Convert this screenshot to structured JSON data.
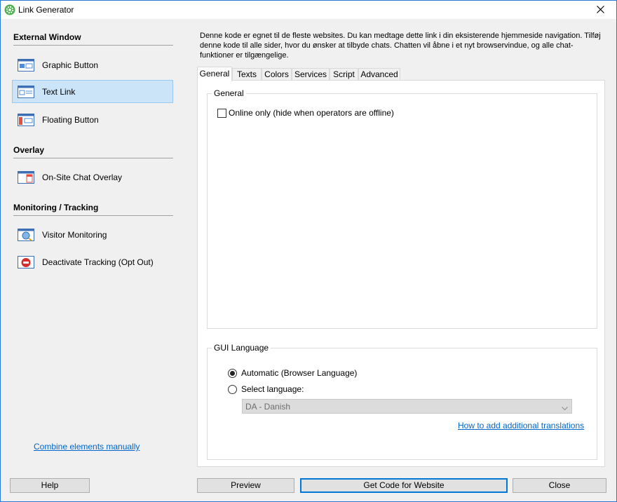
{
  "window": {
    "title": "Link Generator"
  },
  "sidebar": {
    "sections": [
      {
        "title": "External Window"
      },
      {
        "title": "Overlay"
      },
      {
        "title": "Monitoring / Tracking"
      }
    ],
    "items": [
      {
        "label": "Graphic Button",
        "icon": "graphic-button-icon"
      },
      {
        "label": "Text Link",
        "icon": "text-link-icon",
        "selected": true
      },
      {
        "label": "Floating Button",
        "icon": "floating-button-icon"
      },
      {
        "label": "On-Site Chat Overlay",
        "icon": "chat-overlay-icon"
      },
      {
        "label": "Visitor Monitoring",
        "icon": "visitor-monitoring-icon"
      },
      {
        "label": "Deactivate Tracking (Opt Out)",
        "icon": "deactivate-tracking-icon"
      }
    ],
    "combine_link": "Combine elements manually"
  },
  "main": {
    "intro": "Denne kode er egnet til de fleste websites. Du kan medtage dette link i din eksisterende hjemmeside navigation. Tilføj denne kode til alle sider, hvor du ønsker at tilbyde chats. Chatten vil åbne i et nyt browservindue, og alle chat-funktioner er tilgængelige.",
    "tabs": [
      "General",
      "Texts",
      "Colors",
      "Services",
      "Script",
      "Advanced"
    ],
    "active_tab": "General",
    "general_group": {
      "title": "General",
      "online_only_label": "Online only (hide when operators are offline)",
      "online_only_checked": false
    },
    "language_group": {
      "title": "GUI Language",
      "automatic_label": "Automatic (Browser Language)",
      "select_label": "Select language:",
      "selected_option": "automatic",
      "language_value": "DA - Danish",
      "translations_link": "How to add additional translations"
    }
  },
  "buttons": {
    "help": "Help",
    "preview": "Preview",
    "get_code": "Get Code for Website",
    "close": "Close"
  },
  "colors": {
    "accent": "#0078d7",
    "selected_bg": "#cce4f7",
    "link": "#0066cc"
  }
}
